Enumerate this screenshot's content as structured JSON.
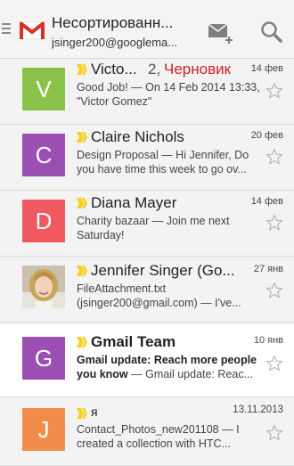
{
  "header": {
    "title": "Несортированн...",
    "account": "jsinger200@googlema..."
  },
  "colors": {
    "green": "#8bc34a",
    "purple": "#9c4fb3",
    "red": "#f0595f",
    "orange": "#f28c4a",
    "draft_red": "#cc1f1f",
    "importance_yellow": "#f5d020"
  },
  "emails": [
    {
      "avatar_letter": "V",
      "sender": "Victo...",
      "draft_count": "2,",
      "draft_label": "Черновик",
      "date": "14 фев",
      "subject": "Good Job!",
      "snippet": " — On 14 Feb 2014 13:33, \"Victor Gomez\"",
      "unread": false
    },
    {
      "avatar_letter": "C",
      "sender": "Claire Nichols",
      "date": "20 фев",
      "subject": "Design Proposal",
      "snippet": " — Hi Jennifer, Do you have time this week to go ov...",
      "unread": false
    },
    {
      "avatar_letter": "D",
      "sender": "Diana Mayer",
      "date": "14 фев",
      "subject": "Charity bazaar",
      "snippet": " — Join me next Saturday!",
      "unread": false
    },
    {
      "avatar_letter": "",
      "sender": "Jennifer Singer (Go...",
      "date": "27 янв",
      "subject": "FileAttachment.txt",
      "snippet": " (jsinger200@gmail.com) — I've...",
      "unread": false
    },
    {
      "avatar_letter": "G",
      "sender": "Gmail Team",
      "date": "10 янв",
      "subject": "Gmail update: Reach more people you know",
      "snippet": " — Gmail update: Reac...",
      "unread": true
    },
    {
      "avatar_letter": "J",
      "sender": "я",
      "date": "13.11.2013",
      "subject": "Contact_Photos_new201108",
      "snippet": " — I created a collection with HTC...",
      "unread": false
    }
  ]
}
